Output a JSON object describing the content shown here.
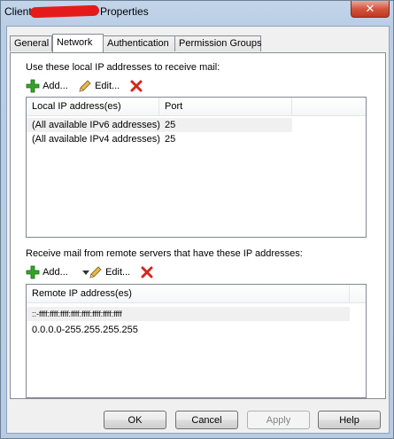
{
  "window": {
    "title_prefix": "Client",
    "title_suffix": "Properties",
    "close_symbol": "✕"
  },
  "tabs": [
    {
      "label": "General",
      "active": false
    },
    {
      "label": "Network",
      "active": true
    },
    {
      "label": "Authentication",
      "active": false
    },
    {
      "label": "Permission Groups",
      "active": false
    }
  ],
  "local": {
    "section_label": "Use these local IP addresses to receive mail:",
    "add_label": "Add...",
    "edit_label": "Edit...",
    "columns": [
      "Local IP address(es)",
      "Port"
    ],
    "rows": [
      {
        "address": "(All available IPv6 addresses)",
        "port": "25"
      },
      {
        "address": "(All available IPv4 addresses)",
        "port": "25"
      }
    ]
  },
  "remote": {
    "section_label": "Receive mail from remote servers that have these IP addresses:",
    "add_label": "Add...",
    "edit_label": "Edit...",
    "column": "Remote IP address(es)",
    "rows": [
      {
        "address": "::-ffff:ffff:ffff:ffff:ffff:ffff:ffff:ffff"
      },
      {
        "address": "0.0.0.0-255.255.255.255"
      }
    ]
  },
  "buttons": {
    "ok": "OK",
    "cancel": "Cancel",
    "apply": "Apply",
    "help": "Help"
  },
  "icons": {
    "add": "green-plus-icon",
    "edit": "pencil-icon",
    "remove": "red-x-icon",
    "dropdown": "triangle-down-icon"
  },
  "colors": {
    "add_green": "#2e9a22",
    "remove_red": "#d0271d",
    "title_redaction": "#e51b1b"
  }
}
